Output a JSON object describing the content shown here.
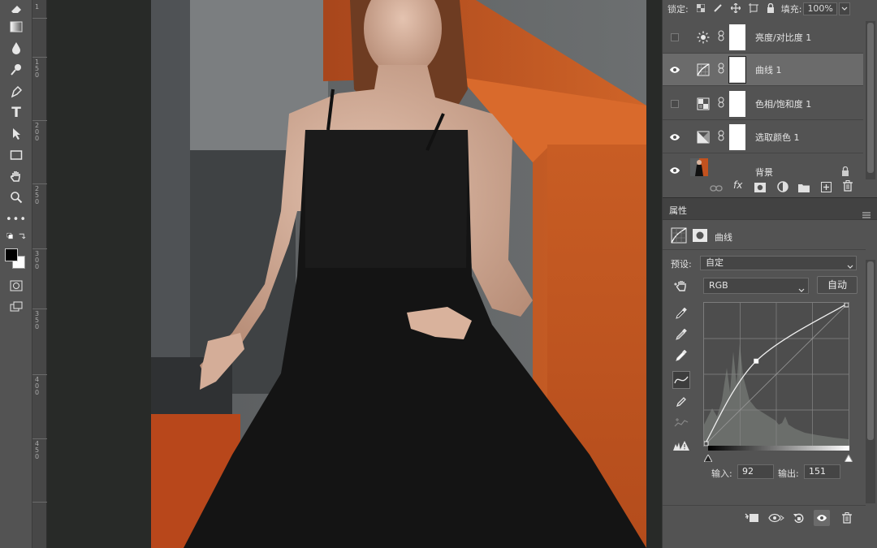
{
  "layers_panel": {
    "lock_label": "锁定:",
    "fill_label": "填充:",
    "fill_value": "100%",
    "layers": [
      {
        "name": "亮度/对比度 1",
        "visible": false,
        "icon": "sun-icon",
        "selected": false
      },
      {
        "name": "曲线 1",
        "visible": true,
        "icon": "curves-icon",
        "selected": true
      },
      {
        "name": "色相/饱和度 1",
        "visible": false,
        "icon": "hue-saturation-icon",
        "selected": false
      },
      {
        "name": "选取颜色 1",
        "visible": true,
        "icon": "selective-color-icon",
        "selected": false
      },
      {
        "name": "背景",
        "visible": true,
        "icon": "photo-thumbnail",
        "selected": false
      }
    ]
  },
  "properties_panel": {
    "tab_label": "属性",
    "adjustment_name": "曲线",
    "preset_label": "预设:",
    "preset_value": "自定",
    "channel_value": "RGB",
    "auto_button": "自动",
    "input_label": "输入:",
    "input_value": "92",
    "output_label": "输出:",
    "output_value": "151"
  },
  "curve": {
    "points": [
      [
        0,
        0
      ],
      [
        92,
        151
      ],
      [
        255,
        255
      ]
    ]
  },
  "ruler": {
    "numbers": [
      "1",
      "1 5 0",
      "2 0 0",
      "2 5 0",
      "3 0 0",
      "3 5 0",
      "4 0 0",
      "4 5 0"
    ]
  },
  "colors": {
    "accent": "#ffffff",
    "panel_bg": "#535353",
    "selected_layer": "#6b6b6b",
    "photo_orange": "#c2521f"
  }
}
